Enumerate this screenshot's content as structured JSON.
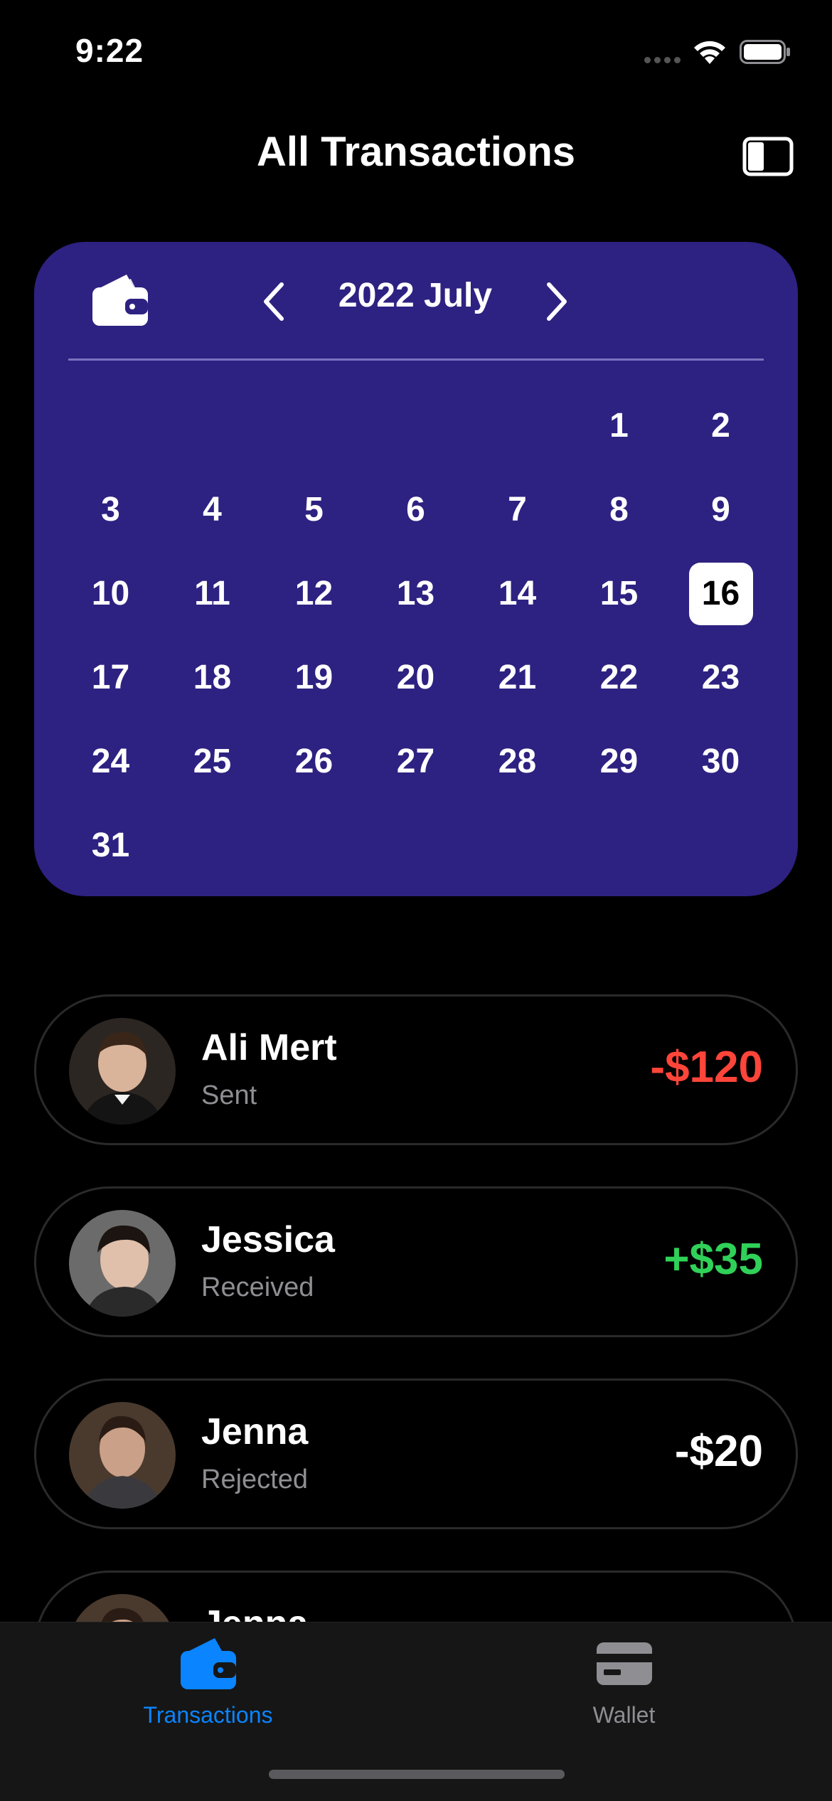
{
  "status_bar": {
    "time": "9:22"
  },
  "header": {
    "title": "All Transactions",
    "sidebar_icon": "sidebar-toggle-icon"
  },
  "calendar": {
    "month_label": "2022 July",
    "wallet_icon": "wallet-icon",
    "prev_icon": "chevron-left-icon",
    "next_icon": "chevron-right-icon",
    "first_weekday_index": 5,
    "days": [
      "1",
      "2",
      "3",
      "4",
      "5",
      "6",
      "7",
      "8",
      "9",
      "10",
      "11",
      "12",
      "13",
      "14",
      "15",
      "16",
      "17",
      "18",
      "19",
      "20",
      "21",
      "22",
      "23",
      "24",
      "25",
      "26",
      "27",
      "28",
      "29",
      "30",
      "31"
    ],
    "selected_day": "16",
    "background_color": "#2d2281"
  },
  "transactions": [
    {
      "name": "Ali Mert",
      "status": "Sent",
      "amount": "-$120",
      "amount_color": "#ff453a",
      "avatar": "avatar-photo"
    },
    {
      "name": "Jessica",
      "status": "Received",
      "amount": "+$35",
      "amount_color": "#30d158",
      "avatar": "avatar-photo"
    },
    {
      "name": "Jenna",
      "status": "Rejected",
      "amount": "-$20",
      "amount_color": "#ffffff",
      "avatar": "avatar-photo"
    },
    {
      "name": "Jenna",
      "status": "",
      "amount": "",
      "amount_color": "#ffffff",
      "avatar": "avatar-photo"
    }
  ],
  "tab_bar": {
    "tabs": [
      {
        "label": "Transactions",
        "icon": "wallet-icon",
        "active": true,
        "color": "#0a84ff"
      },
      {
        "label": "Wallet",
        "icon": "card-icon",
        "active": false,
        "color": "#8e8e93"
      }
    ]
  }
}
